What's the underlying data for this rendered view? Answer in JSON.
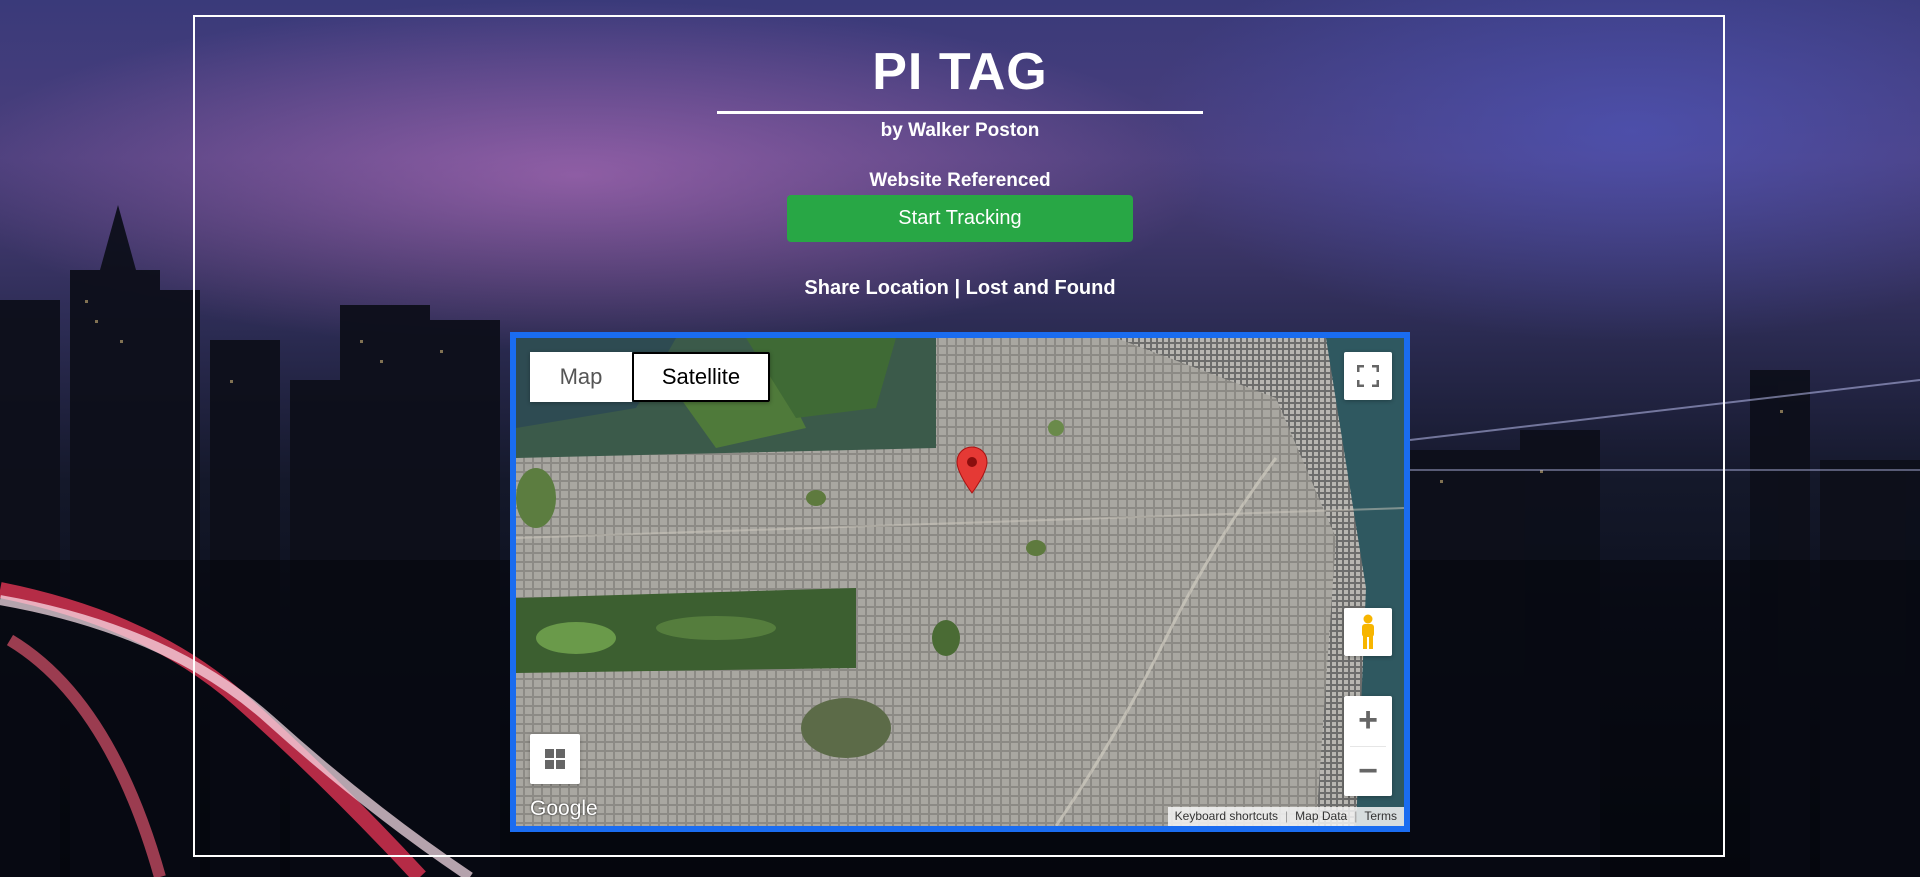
{
  "header": {
    "title": "PI TAG",
    "byline": "by Walker Poston",
    "referenced": "Website Referenced"
  },
  "actions": {
    "start_tracking": "Start Tracking"
  },
  "links": {
    "share_location": "Share Location",
    "separator": " | ",
    "lost_and_found": "Lost and Found"
  },
  "map": {
    "type_controls": {
      "map_label": "Map",
      "satellite_label": "Satellite",
      "selected": "Satellite"
    },
    "logo": "Google",
    "attribution": {
      "keyboard_shortcuts": "Keyboard shortcuts",
      "map_data": "Map Data",
      "terms": "Terms"
    },
    "icons": [
      "fullscreen-icon",
      "pegman-icon",
      "zoom-in-icon",
      "zoom-out-icon",
      "layers-icon",
      "map-pin-icon"
    ]
  },
  "colors": {
    "accent_button": "#28a745",
    "map_border": "#1a6cf0",
    "frame": "#ffffff",
    "pin": "#e53935"
  }
}
